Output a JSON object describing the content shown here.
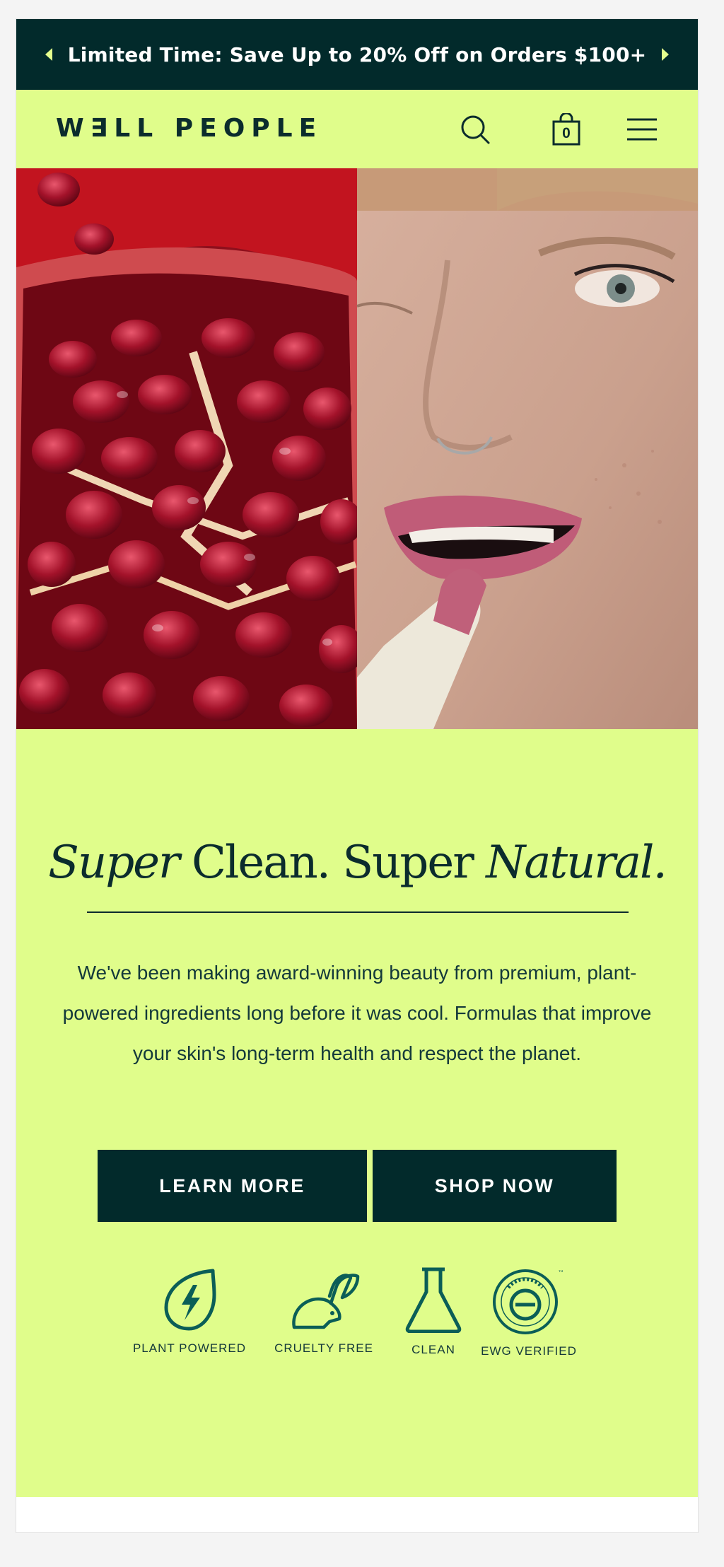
{
  "promo": {
    "text": "Limited Time: Save Up to 20% Off on Orders $100+"
  },
  "header": {
    "logo": "W∃LL PEOPLE",
    "cart_count": "0"
  },
  "hero": {
    "left_image": "pomegranate",
    "right_image": "model applying lipstick"
  },
  "main": {
    "headline_part1": "Super",
    "headline_part2": " Clean. Super ",
    "headline_part3": "Natural.",
    "description": "We've been making award-winning beauty from premium, plant- powered ingredients long before it was cool. Formulas that improve your skin's long-term health and respect the planet.",
    "learn_more_label": "LEARN MORE",
    "shop_now_label": "SHOP NOW"
  },
  "badges": [
    {
      "label": "PLANT POWERED",
      "icon": "leaf-bolt-icon"
    },
    {
      "label": "CRUELTY FREE",
      "icon": "bunny-icon"
    },
    {
      "label": "CLEAN",
      "icon": "flask-icon"
    },
    {
      "label": "EWG VERIFIED",
      "icon": "ewg-seal-icon",
      "tm": "™"
    }
  ],
  "colors": {
    "dark": "#022a2b",
    "lime": "#e0fd8b",
    "accent": "#e4ff8d"
  }
}
